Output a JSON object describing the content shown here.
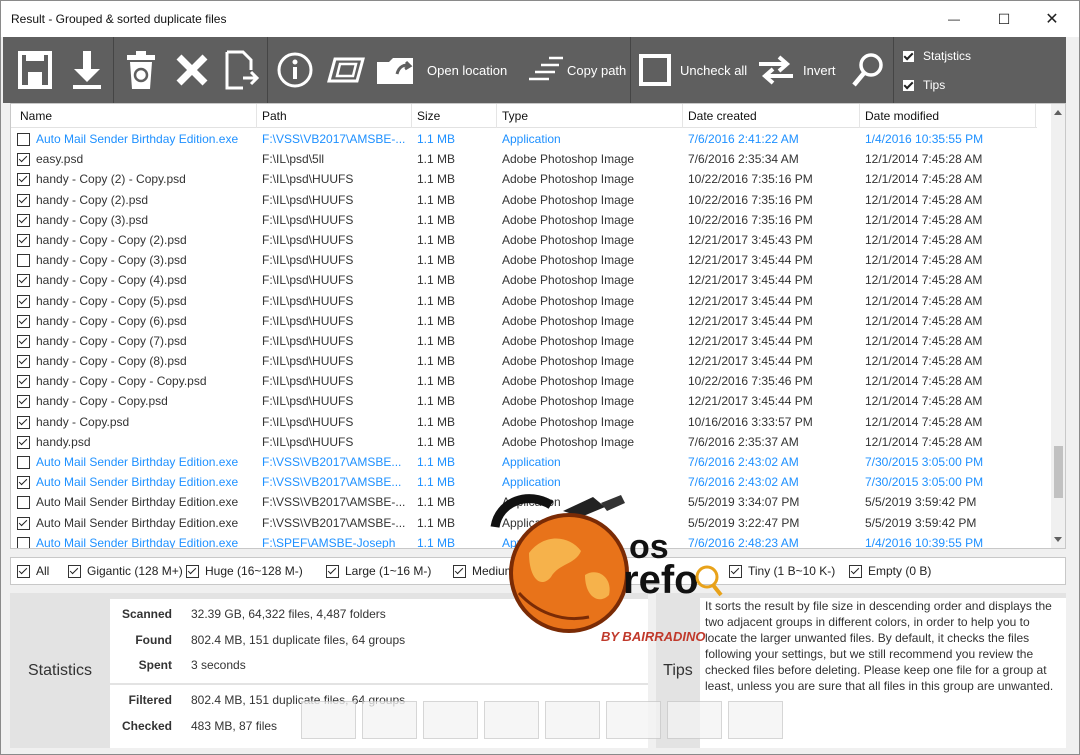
{
  "window": {
    "title": "Result - Grouped & sorted duplicate files",
    "min_glyph": "—",
    "max_glyph": "☐",
    "close_glyph": "✕"
  },
  "toolbar": {
    "open_location_label": "Open location",
    "copy_path_label": "Copy path",
    "uncheck_all_label": "Uncheck all",
    "invert_label": "Invert",
    "statistics_label": "Statjstics",
    "tips_label": "Tips",
    "icons": [
      "save-icon",
      "download-icon",
      "recycle-bin-icon",
      "delete-icon",
      "export-icon",
      "info-icon",
      "preview-icon",
      "open-folder-icon",
      "copy-path-icon",
      "uncheck-all-icon",
      "invert-icon",
      "search-icon"
    ]
  },
  "columns": {
    "name": "Name",
    "path": "Path",
    "size": "Size",
    "type": "Type",
    "created": "Date created",
    "modified": "Date modified"
  },
  "rows": [
    {
      "checked": false,
      "highlight": true,
      "name": "Auto Mail Sender Birthday Edition.exe",
      "path": "F:\\VSS\\VB2017\\AMSBE-...",
      "size": "1.1 MB",
      "type": "Application",
      "created": "7/6/2016 2:41:22 AM",
      "modified": "1/4/2016 10:35:55 PM"
    },
    {
      "checked": true,
      "highlight": false,
      "name": "easy.psd",
      "path": "F:\\IL\\psd\\5ll",
      "size": "1.1 MB",
      "type": "Adobe Photoshop Image",
      "created": "7/6/2016 2:35:34 AM",
      "modified": "12/1/2014 7:45:28 AM"
    },
    {
      "checked": true,
      "highlight": false,
      "name": "handy - Copy (2) - Copy.psd",
      "path": "F:\\IL\\psd\\HUUFS",
      "size": "1.1 MB",
      "type": "Adobe Photoshop Image",
      "created": "10/22/2016 7:35:16 PM",
      "modified": "12/1/2014 7:45:28 AM"
    },
    {
      "checked": true,
      "highlight": false,
      "name": "handy - Copy (2).psd",
      "path": "F:\\IL\\psd\\HUUFS",
      "size": "1.1 MB",
      "type": "Adobe Photoshop Image",
      "created": "10/22/2016 7:35:16 PM",
      "modified": "12/1/2014 7:45:28 AM"
    },
    {
      "checked": true,
      "highlight": false,
      "name": "handy - Copy (3).psd",
      "path": "F:\\IL\\psd\\HUUFS",
      "size": "1.1 MB",
      "type": "Adobe Photoshop Image",
      "created": "10/22/2016 7:35:16 PM",
      "modified": "12/1/2014 7:45:28 AM"
    },
    {
      "checked": true,
      "highlight": false,
      "name": "handy - Copy - Copy (2).psd",
      "path": "F:\\IL\\psd\\HUUFS",
      "size": "1.1 MB",
      "type": "Adobe Photoshop Image",
      "created": "12/21/2017 3:45:43 PM",
      "modified": "12/1/2014 7:45:28 AM"
    },
    {
      "checked": false,
      "highlight": false,
      "name": "handy - Copy - Copy (3).psd",
      "path": "F:\\IL\\psd\\HUUFS",
      "size": "1.1 MB",
      "type": "Adobe Photoshop Image",
      "created": "12/21/2017 3:45:44 PM",
      "modified": "12/1/2014 7:45:28 AM"
    },
    {
      "checked": true,
      "highlight": false,
      "name": "handy - Copy - Copy (4).psd",
      "path": "F:\\IL\\psd\\HUUFS",
      "size": "1.1 MB",
      "type": "Adobe Photoshop Image",
      "created": "12/21/2017 3:45:44 PM",
      "modified": "12/1/2014 7:45:28 AM"
    },
    {
      "checked": true,
      "highlight": false,
      "name": "handy - Copy - Copy (5).psd",
      "path": "F:\\IL\\psd\\HUUFS",
      "size": "1.1 MB",
      "type": "Adobe Photoshop Image",
      "created": "12/21/2017 3:45:44 PM",
      "modified": "12/1/2014 7:45:28 AM"
    },
    {
      "checked": true,
      "highlight": false,
      "name": "handy - Copy - Copy (6).psd",
      "path": "F:\\IL\\psd\\HUUFS",
      "size": "1.1 MB",
      "type": "Adobe Photoshop Image",
      "created": "12/21/2017 3:45:44 PM",
      "modified": "12/1/2014 7:45:28 AM"
    },
    {
      "checked": true,
      "highlight": false,
      "name": "handy - Copy - Copy (7).psd",
      "path": "F:\\IL\\psd\\HUUFS",
      "size": "1.1 MB",
      "type": "Adobe Photoshop Image",
      "created": "12/21/2017 3:45:44 PM",
      "modified": "12/1/2014 7:45:28 AM"
    },
    {
      "checked": true,
      "highlight": false,
      "name": "handy - Copy - Copy (8).psd",
      "path": "F:\\IL\\psd\\HUUFS",
      "size": "1.1 MB",
      "type": "Adobe Photoshop Image",
      "created": "12/21/2017 3:45:44 PM",
      "modified": "12/1/2014 7:45:28 AM"
    },
    {
      "checked": true,
      "highlight": false,
      "name": "handy - Copy - Copy - Copy.psd",
      "path": "F:\\IL\\psd\\HUUFS",
      "size": "1.1 MB",
      "type": "Adobe Photoshop Image",
      "created": "10/22/2016 7:35:46 PM",
      "modified": "12/1/2014 7:45:28 AM"
    },
    {
      "checked": true,
      "highlight": false,
      "name": "handy - Copy - Copy.psd",
      "path": "F:\\IL\\psd\\HUUFS",
      "size": "1.1 MB",
      "type": "Adobe Photoshop Image",
      "created": "12/21/2017 3:45:44 PM",
      "modified": "12/1/2014 7:45:28 AM"
    },
    {
      "checked": true,
      "highlight": false,
      "name": "handy - Copy.psd",
      "path": "F:\\IL\\psd\\HUUFS",
      "size": "1.1 MB",
      "type": "Adobe Photoshop Image",
      "created": "10/16/2016 3:33:57 PM",
      "modified": "12/1/2014 7:45:28 AM"
    },
    {
      "checked": true,
      "highlight": false,
      "name": "handy.psd",
      "path": "F:\\IL\\psd\\HUUFS",
      "size": "1.1 MB",
      "type": "Adobe Photoshop Image",
      "created": "7/6/2016 2:35:37 AM",
      "modified": "12/1/2014 7:45:28 AM"
    },
    {
      "checked": false,
      "highlight": true,
      "name": "Auto Mail Sender Birthday Edition.exe",
      "path": "F:\\VSS\\VB2017\\AMSBE...",
      "size": "1.1 MB",
      "type": "Application",
      "created": "7/6/2016 2:43:02 AM",
      "modified": "7/30/2015 3:05:00 PM"
    },
    {
      "checked": true,
      "highlight": true,
      "name": "Auto Mail Sender Birthday Edition.exe",
      "path": "F:\\VSS\\VB2017\\AMSBE...",
      "size": "1.1 MB",
      "type": "Application",
      "created": "7/6/2016 2:43:02 AM",
      "modified": "7/30/2015 3:05:00 PM"
    },
    {
      "checked": false,
      "highlight": false,
      "name": "Auto Mail Sender Birthday Edition.exe",
      "path": "F:\\VSS\\VB2017\\AMSBE-...",
      "size": "1.1 MB",
      "type": "Application",
      "created": "5/5/2019 3:34:07 PM",
      "modified": "5/5/2019 3:59:42 PM"
    },
    {
      "checked": true,
      "highlight": false,
      "name": "Auto Mail Sender Birthday Edition.exe",
      "path": "F:\\VSS\\VB2017\\AMSBE-...",
      "size": "1.1 MB",
      "type": "Application",
      "created": "5/5/2019 3:22:47 PM",
      "modified": "5/5/2019 3:59:42 PM"
    },
    {
      "checked": false,
      "highlight": true,
      "name": "Auto Mail Sender Birthday Edition.exe",
      "path": "F:\\SPEF\\AMSBE-Joseph",
      "size": "1.1 MB",
      "type": "Application",
      "created": "7/6/2016 2:48:23 AM",
      "modified": "1/4/2016 10:39:55 PM"
    }
  ],
  "filters": [
    {
      "label": "All",
      "checked": true
    },
    {
      "label": "Gigantic (128 M+)",
      "checked": true
    },
    {
      "label": "Huge (16~128 M-)",
      "checked": true
    },
    {
      "label": "Large (1~16 M-)",
      "checked": true
    },
    {
      "label": "Medium",
      "checked": true
    },
    {
      "label": "Tiny (1 B~10 K-)",
      "checked": true
    },
    {
      "label": "Empty (0 B)",
      "checked": true
    }
  ],
  "statistics": {
    "title": "Statistics",
    "scanned_label": "Scanned",
    "scanned": "32.39 GB, 64,322 files, 4,487 folders",
    "found_label": "Found",
    "found": "802.4 MB, 151 duplicate files, 64 groups",
    "spent_label": "Spent",
    "spent": "3 seconds",
    "filtered_label": "Filtered",
    "filtered": "802.4 MB, 151 duplicate files, 64 groups",
    "checked_label": "Checked",
    "checked": "483 MB, 87 files"
  },
  "tips": {
    "title": "Tips",
    "text": "It sorts the result by file size in descending order and displays the two adjacent groups in different colors, in order to help you to locate the larger unwanted files. By default, it checks the files following your settings, but we still recommend you review the checked files before deleting. Please keep one file for a group at least, unless you are sure that all files in this group are unwanted."
  },
  "watermark": {
    "text_top": "os",
    "text_main": "refo",
    "byline": "BY BAIRRADINO",
    "colors": {
      "globe": "#e8731a",
      "text": "#111111",
      "byline": "#c0392b"
    }
  },
  "colors": {
    "toolbar_bg": "#5f5f5f",
    "highlight_text": "#1e90ff",
    "panel_bg": "#e3e3e3"
  }
}
